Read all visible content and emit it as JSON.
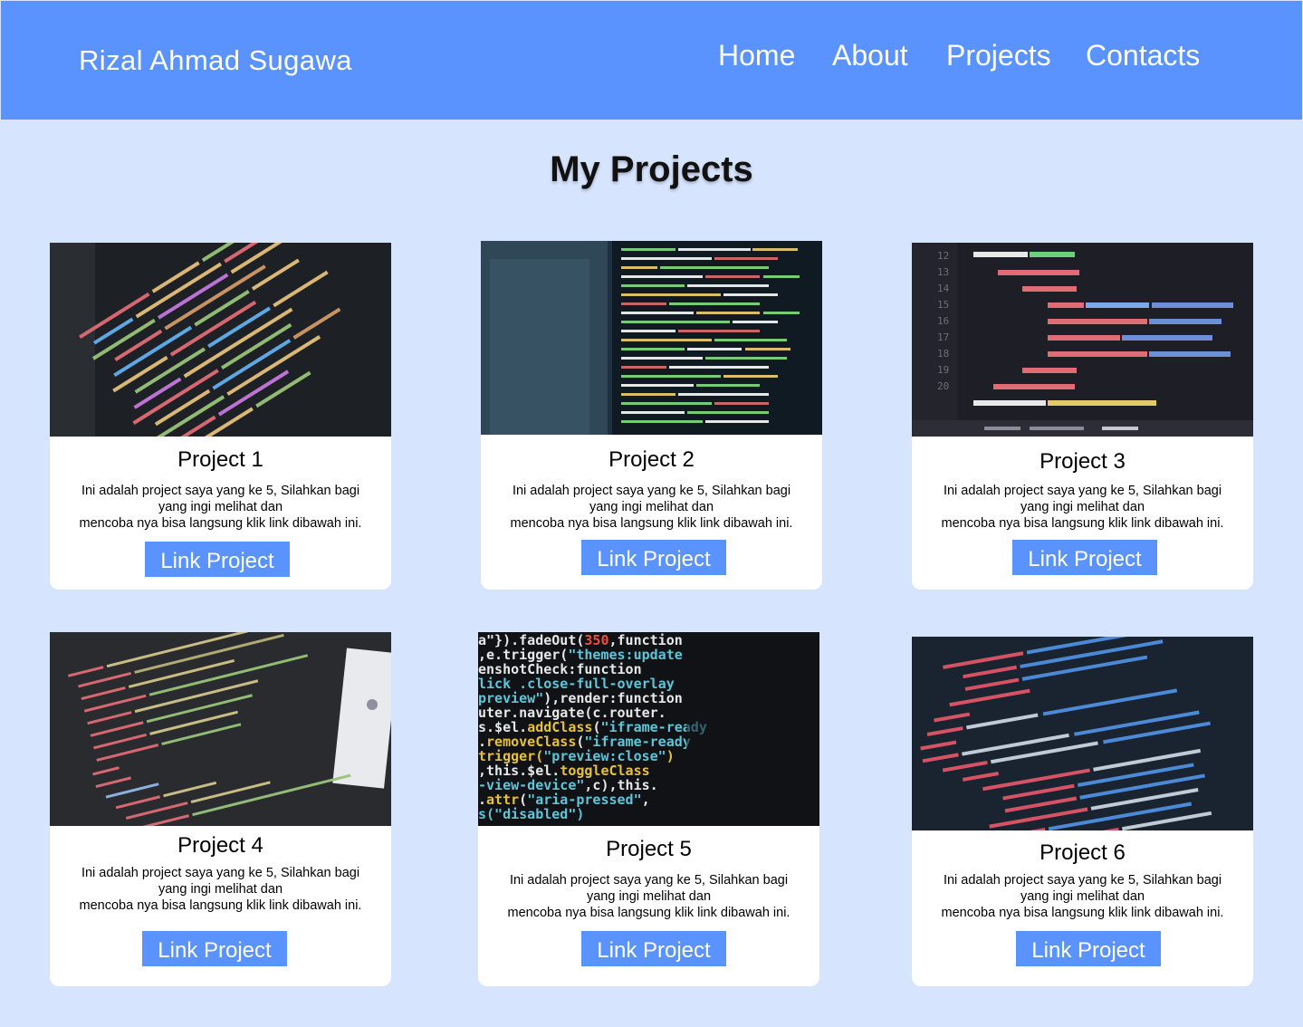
{
  "navbar": {
    "brand": "Rizal Ahmad Sugawa",
    "links": [
      "Home",
      "About",
      "Projects",
      "Contacts"
    ]
  },
  "main": {
    "title": "My Projects"
  },
  "projects": [
    {
      "title": "Project 1",
      "desc": [
        "Ini adalah project saya yang ke 5, Silahkan bagi",
        "yang ingi melihat dan",
        "mencoba nya bisa langsung klik link dibawah ini."
      ],
      "button": "Link Project"
    },
    {
      "title": "Project 2",
      "desc": [
        "Ini adalah project saya yang ke 5, Silahkan bagi",
        "yang ingi melihat dan",
        "mencoba nya bisa langsung klik link dibawah ini."
      ],
      "button": "Link Project"
    },
    {
      "title": "Project 3",
      "desc": [
        "Ini adalah project saya yang ke 5, Silahkan bagi",
        "yang ingi melihat dan",
        "mencoba nya bisa langsung klik link dibawah ini."
      ],
      "button": "Link Project"
    },
    {
      "title": "Project 4",
      "desc": [
        "Ini adalah project saya yang ke 5, Silahkan bagi",
        "yang ingi melihat dan",
        "mencoba nya bisa langsung klik link dibawah ini."
      ],
      "button": "Link Project"
    },
    {
      "title": "Project 5",
      "desc": [
        "Ini adalah project saya yang ke 5, Silahkan bagi",
        "yang ingi melihat dan",
        "mencoba nya bisa langsung klik link dibawah ini."
      ],
      "button": "Link Project"
    },
    {
      "title": "Project 6",
      "desc": [
        "Ini adalah project saya yang ke 5, Silahkan bagi",
        "yang ingi melihat dan",
        "mencoba nya bisa langsung klik link dibawah ini."
      ],
      "button": "Link Project"
    }
  ],
  "colors": {
    "navbar": "#5b93fe",
    "background": "#d7e4fe",
    "button": "#5b93fe",
    "card": "#ffffff"
  }
}
